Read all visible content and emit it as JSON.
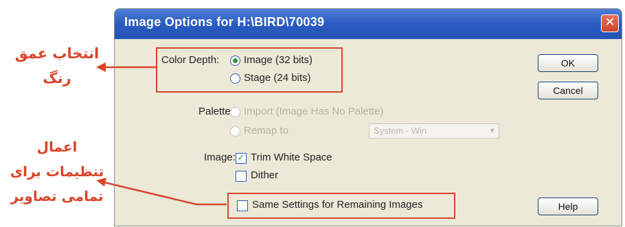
{
  "annotations": {
    "color_depth_note": [
      "انتخاب عمق",
      "رنگ"
    ],
    "apply_all_note": [
      "اعمال",
      "تنظیمات برای",
      "تمامی تصاویر"
    ],
    "accent_color": "#d9452b"
  },
  "dialog": {
    "title": "Image Options for H:\\BIRD\\70039",
    "close_icon": "close-icon"
  },
  "color_depth": {
    "label": "Color Depth:",
    "options": [
      "Image (32 bits)",
      "Stage (24 bits)"
    ],
    "selected": "Image (32 bits)"
  },
  "palette": {
    "label": "Palette:",
    "import_label": "Import (Image Has No Palette)",
    "remap_label": "Remap to",
    "remap_value": "System - Win"
  },
  "image": {
    "label": "Image:",
    "trim_label": "Trim White Space",
    "trim_checked": true,
    "dither_label": "Dither",
    "dither_checked": false
  },
  "same_settings": {
    "label": "Same Settings for Remaining Images",
    "checked": false
  },
  "buttons": {
    "ok": "OK",
    "cancel": "Cancel",
    "help": "Help"
  }
}
